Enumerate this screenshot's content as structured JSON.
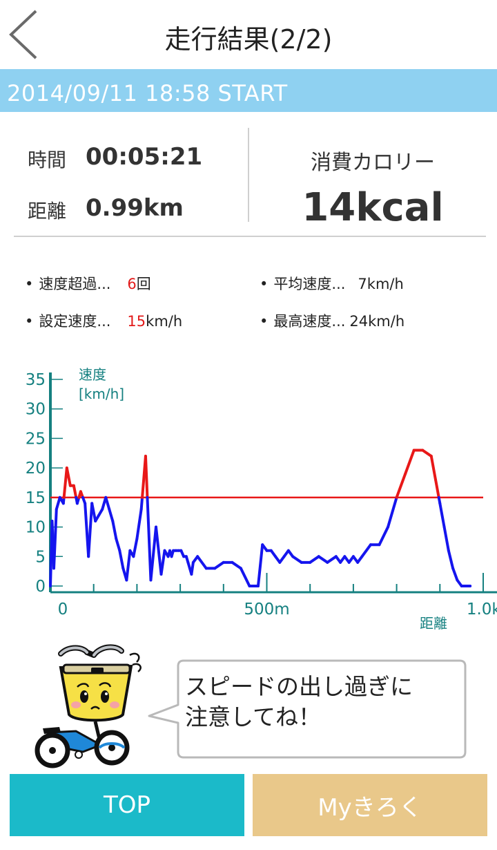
{
  "header": {
    "title": "走行結果(2/2)"
  },
  "banner": {
    "text": "2014/09/11 18:58 START"
  },
  "summary": {
    "time_label": "時間",
    "time_value": "00:05:21",
    "distance_label": "距離",
    "distance_value": "0.99km",
    "calorie_label": "消費カロリー",
    "calorie_value": "14kcal"
  },
  "stats": {
    "over_speed_label": "速度超過...",
    "over_speed_value": "6",
    "over_speed_unit": "回",
    "set_speed_label": "設定速度...",
    "set_speed_value": "15",
    "set_speed_unit": "km/h",
    "avg_speed_label": "平均速度...",
    "avg_speed_value": "7km/h",
    "max_speed_label": "最高速度...",
    "max_speed_value": "24km/h"
  },
  "chart_data": {
    "type": "line",
    "ylabel_line1": "速度",
    "ylabel_line2": "[km/h]",
    "xlabel": "距離",
    "y_ticks": [
      "35",
      "30",
      "25",
      "20",
      "15",
      "10",
      "5",
      "0"
    ],
    "x_ticks": [
      "0",
      "500m",
      "1.0km"
    ],
    "ylim": [
      0,
      35
    ],
    "xlim_m": [
      0,
      1000
    ],
    "threshold_kmh": 15,
    "colors": {
      "under": "#1515ee",
      "over": "#e81818",
      "threshold": "#e81818",
      "axis": "#158080"
    },
    "x": [
      0,
      4,
      8,
      14,
      22,
      30,
      38,
      46,
      54,
      62,
      70,
      80,
      88,
      96,
      104,
      112,
      120,
      128,
      136,
      144,
      152,
      160,
      168,
      176,
      184,
      192,
      200,
      210,
      220,
      232,
      244,
      256,
      264,
      272,
      276,
      280,
      284,
      290,
      296,
      302,
      308,
      314,
      318,
      322,
      326,
      330,
      340,
      360,
      380,
      400,
      420,
      440,
      460,
      480,
      490,
      500,
      510,
      520,
      530,
      540,
      550,
      560,
      580,
      600,
      620,
      640,
      660,
      670,
      680,
      690,
      700,
      710,
      720,
      740,
      760,
      780,
      800,
      820,
      840,
      860,
      880,
      890,
      900,
      910,
      920,
      930,
      940,
      950,
      960,
      965,
      970
    ],
    "values": [
      0,
      11,
      3,
      13,
      15,
      14,
      20,
      17,
      17,
      14,
      16,
      14,
      5,
      14,
      11,
      12,
      13,
      15,
      13,
      11,
      8,
      6,
      3,
      1,
      6,
      5,
      8,
      13,
      22,
      1,
      10,
      2,
      6,
      5,
      6,
      5,
      6,
      6,
      6,
      6,
      5,
      5,
      4,
      3,
      2,
      4,
      5,
      3,
      3,
      4,
      4,
      3,
      0,
      0,
      7,
      6,
      6,
      5,
      4,
      5,
      6,
      5,
      4,
      4,
      5,
      4,
      5,
      4,
      5,
      4,
      5,
      4,
      5,
      7,
      7,
      10,
      15,
      19,
      23,
      23,
      22,
      18,
      14,
      10,
      6,
      3,
      1,
      0,
      0,
      0,
      0
    ]
  },
  "mascot": {
    "message_line1": "スピードの出し過ぎに",
    "message_line2": "注意してね！"
  },
  "buttons": {
    "top_label": "TOP",
    "my_label": "Myきろく"
  }
}
